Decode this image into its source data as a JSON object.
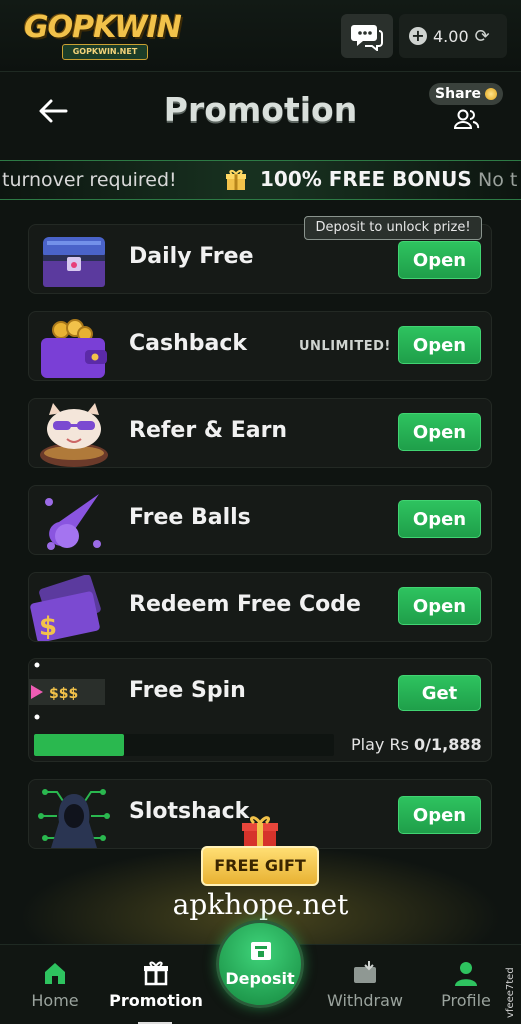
{
  "app": {
    "logo_text": "GOPKWIN",
    "logo_sub": "GOPKWIN.NET",
    "balance": "4.00"
  },
  "header": {
    "title": "Promotion",
    "share_label": "Share"
  },
  "marquee": {
    "left_text": "turnover required!",
    "bonus_text": "100% FREE BONUS",
    "right_text": "No t"
  },
  "promotions": [
    {
      "title": "Daily Free",
      "button": "Open",
      "tooltip": "Deposit to unlock prize!"
    },
    {
      "title": "Cashback",
      "button": "Open",
      "tag": "UNLIMITED!"
    },
    {
      "title": "Refer & Earn",
      "button": "Open"
    },
    {
      "title": "Free Balls",
      "button": "Open"
    },
    {
      "title": "Redeem Free Code",
      "button": "Open"
    },
    {
      "title": "Free Spin",
      "button": "Get",
      "icon_text": "$$$",
      "progress_label": "Play Rs",
      "progress_value": "0/1,888",
      "progress_fraction": 0.3
    },
    {
      "title": "Slotshack",
      "button": "Open"
    }
  ],
  "free_gift": {
    "label": "FREE GIFT"
  },
  "watermark": "apkhope.net",
  "bottom_nav": {
    "home": "Home",
    "promotion": "Promotion",
    "deposit": "Deposit",
    "withdraw": "Withdraw",
    "profile": "Profile"
  },
  "side_credit": "vfeee7ted",
  "colors": {
    "accent_green": "#2ec35f",
    "gold": "#f2c24a",
    "background": "#0f1411"
  }
}
